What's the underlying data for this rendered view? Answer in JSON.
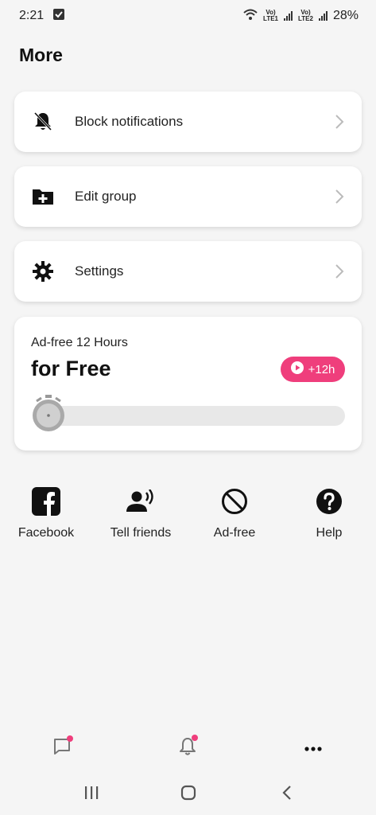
{
  "status_bar": {
    "time": "2:21",
    "sim1": "LTE1",
    "sim2": "LTE2",
    "volte": "Vo)",
    "battery": "28%"
  },
  "page": {
    "title": "More"
  },
  "menu": [
    {
      "label": "Block notifications",
      "icon": "bell-off-icon"
    },
    {
      "label": "Edit group",
      "icon": "folder-plus-icon"
    },
    {
      "label": "Settings",
      "icon": "gear-icon"
    }
  ],
  "ad_free": {
    "subtitle": "Ad-free 12 Hours",
    "title": "for Free",
    "badge": "+12h",
    "progress": 0.0
  },
  "shortcuts": [
    {
      "label": "Facebook",
      "icon": "facebook-icon"
    },
    {
      "label": "Tell friends",
      "icon": "speaking-person-icon"
    },
    {
      "label": "Ad-free",
      "icon": "ban-icon"
    },
    {
      "label": "Help",
      "icon": "help-icon"
    }
  ],
  "bottom_nav": [
    {
      "icon": "chat-icon",
      "badge": true
    },
    {
      "icon": "bell-icon",
      "badge": true
    },
    {
      "icon": "more-dots-icon",
      "badge": false
    }
  ],
  "colors": {
    "accent": "#ef3e7c",
    "background": "#f5f5f5",
    "card": "#ffffff"
  }
}
